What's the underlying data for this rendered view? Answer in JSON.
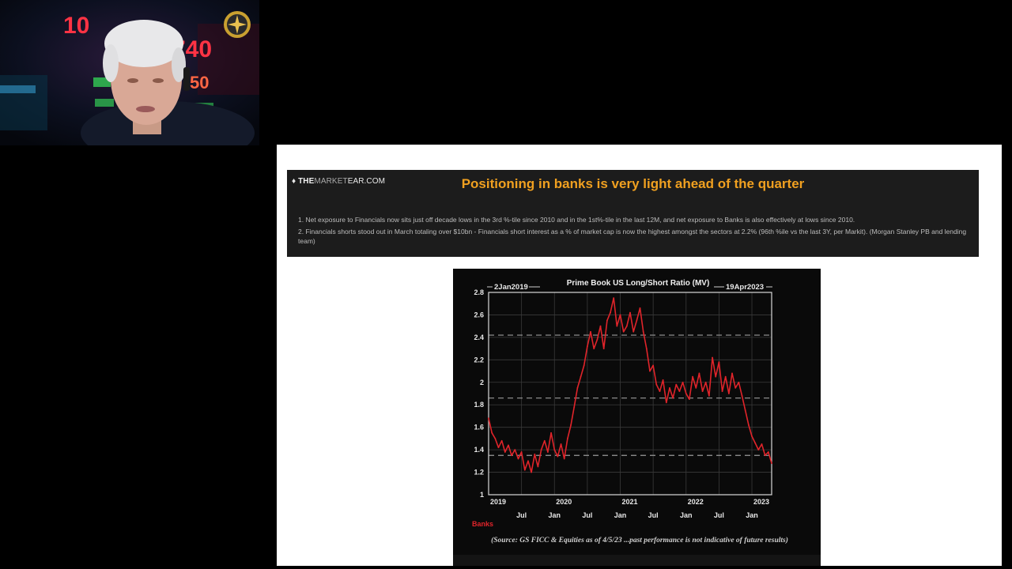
{
  "webcam": {
    "ticker_text_1": "10",
    "ticker_text_2": "740",
    "ticker_text_3": "50"
  },
  "slide": {
    "brand_part1": "THE",
    "brand_part2": "MARKET",
    "brand_part3": "EAR.COM",
    "title": "Positioning in banks is very light ahead of the quarter",
    "notes": [
      "1. Net exposure to Financials now sits just off decade lows in the 3rd %-tile since 2010 and in the 1st%-tile in the last 12M, and net exposure to Banks is also effectively at lows since 2010.",
      "2. Financials shorts stood out in March totaling over $10bn - Financials short interest as a % of market cap is now the highest amongst the sectors at 2.2% (96th %ile vs the last 3Y, per Markit). (Morgan Stanley PB and lending team)"
    ]
  },
  "chart_data": {
    "type": "line",
    "title": "Prime Book US Long/Short Ratio (MV)",
    "start_label": "2Jan2019",
    "end_label": "19Apr2023",
    "ylim": [
      1,
      2.8
    ],
    "y_ticks": [
      1,
      1.2,
      1.4,
      1.6,
      1.8,
      2,
      2.2,
      2.4,
      2.6,
      2.8
    ],
    "x_ticks": [
      {
        "label": "2019",
        "row": 1,
        "x": 2019.0
      },
      {
        "label": "Jul",
        "row": 2,
        "x": 2019.5
      },
      {
        "label": "2020",
        "row": 1,
        "x": 2020.0
      },
      {
        "label": "Jan",
        "row": 2,
        "x": 2020.0
      },
      {
        "label": "Jul",
        "row": 2,
        "x": 2020.5
      },
      {
        "label": "2021",
        "row": 1,
        "x": 2021.0
      },
      {
        "label": "Jan",
        "row": 2,
        "x": 2021.0
      },
      {
        "label": "Jul",
        "row": 2,
        "x": 2021.5
      },
      {
        "label": "2022",
        "row": 1,
        "x": 2022.0
      },
      {
        "label": "Jan",
        "row": 2,
        "x": 2022.0
      },
      {
        "label": "Jul",
        "row": 2,
        "x": 2022.5
      },
      {
        "label": "2023",
        "row": 1,
        "x": 2023.0
      },
      {
        "label": "Jan",
        "row": 2,
        "x": 2023.0
      }
    ],
    "reference_lines": [
      2.42,
      1.86,
      1.35
    ],
    "series": [
      {
        "name": "Banks",
        "color": "#e0242a",
        "x": [
          2019.0,
          2019.05,
          2019.1,
          2019.15,
          2019.2,
          2019.25,
          2019.3,
          2019.35,
          2019.4,
          2019.45,
          2019.5,
          2019.55,
          2019.6,
          2019.65,
          2019.7,
          2019.75,
          2019.8,
          2019.85,
          2019.9,
          2019.95,
          2020.0,
          2020.05,
          2020.1,
          2020.15,
          2020.2,
          2020.25,
          2020.3,
          2020.35,
          2020.4,
          2020.45,
          2020.5,
          2020.55,
          2020.6,
          2020.65,
          2020.7,
          2020.75,
          2020.8,
          2020.85,
          2020.9,
          2020.95,
          2021.0,
          2021.05,
          2021.1,
          2021.15,
          2021.2,
          2021.25,
          2021.3,
          2021.35,
          2021.4,
          2021.45,
          2021.5,
          2021.55,
          2021.6,
          2021.65,
          2021.7,
          2021.75,
          2021.8,
          2021.85,
          2021.9,
          2021.95,
          2022.0,
          2022.05,
          2022.1,
          2022.15,
          2022.2,
          2022.25,
          2022.3,
          2022.35,
          2022.4,
          2022.45,
          2022.5,
          2022.55,
          2022.6,
          2022.65,
          2022.7,
          2022.75,
          2022.8,
          2022.85,
          2022.9,
          2022.95,
          2023.0,
          2023.05,
          2023.1,
          2023.15,
          2023.2,
          2023.25,
          2023.3
        ],
        "values": [
          1.68,
          1.55,
          1.5,
          1.42,
          1.48,
          1.38,
          1.44,
          1.35,
          1.4,
          1.32,
          1.38,
          1.22,
          1.3,
          1.2,
          1.36,
          1.25,
          1.4,
          1.48,
          1.38,
          1.55,
          1.4,
          1.34,
          1.45,
          1.32,
          1.5,
          1.62,
          1.78,
          1.95,
          2.05,
          2.15,
          2.32,
          2.45,
          2.3,
          2.38,
          2.5,
          2.3,
          2.55,
          2.62,
          2.75,
          2.5,
          2.6,
          2.45,
          2.5,
          2.62,
          2.45,
          2.55,
          2.66,
          2.45,
          2.3,
          2.1,
          2.15,
          1.98,
          1.92,
          2.02,
          1.82,
          1.95,
          1.86,
          1.98,
          1.92,
          2.0,
          1.9,
          1.85,
          2.05,
          1.95,
          2.08,
          1.92,
          2.0,
          1.88,
          2.22,
          2.05,
          2.18,
          1.92,
          2.05,
          1.9,
          2.08,
          1.95,
          2.0,
          1.88,
          1.75,
          1.62,
          1.52,
          1.46,
          1.4,
          1.45,
          1.35,
          1.38,
          1.28
        ]
      }
    ],
    "legend": "bottom-left",
    "source": "(Source: GS FICC & Equities as of 4/5/23 ...past performance is not indicative of future results)"
  }
}
